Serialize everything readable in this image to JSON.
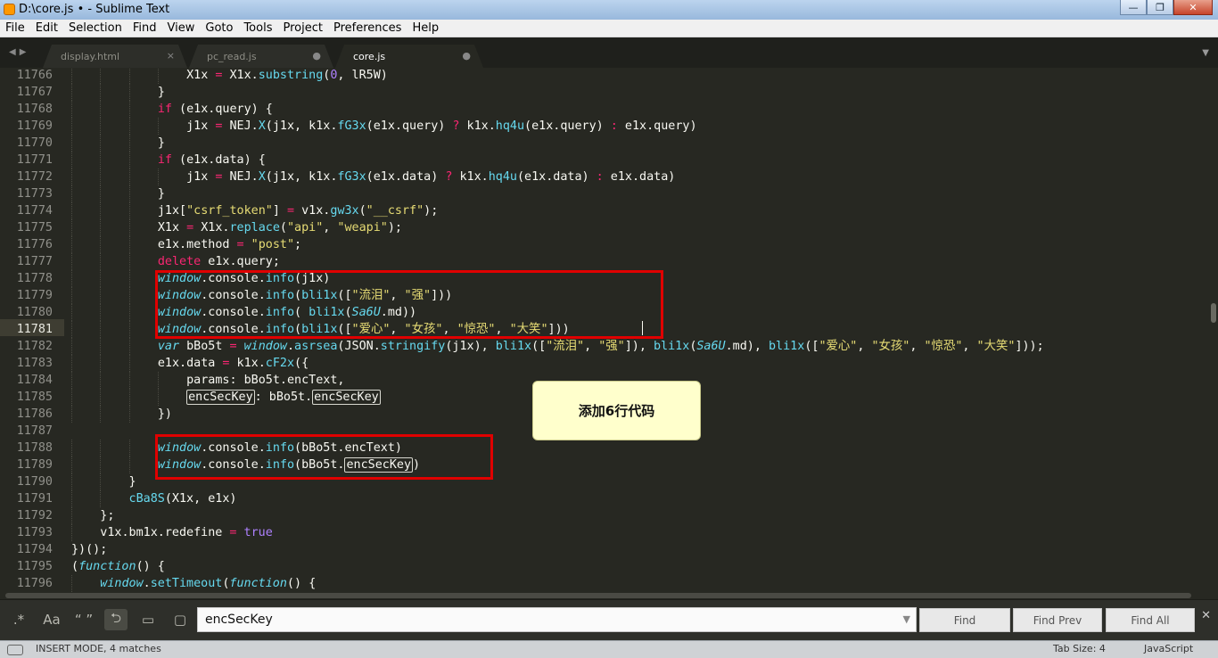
{
  "window": {
    "title": "D:\\core.js • - Sublime Text",
    "controls": {
      "minimize": "—",
      "maximize": "❐",
      "close": "✕"
    }
  },
  "menu": [
    "File",
    "Edit",
    "Selection",
    "Find",
    "View",
    "Goto",
    "Tools",
    "Project",
    "Preferences",
    "Help"
  ],
  "tabs": [
    {
      "label": "display.html",
      "marker": "×",
      "active": false
    },
    {
      "label": "pc_read.js",
      "marker": "●",
      "active": false
    },
    {
      "label": "core.js",
      "marker": "●",
      "active": true
    }
  ],
  "editor": {
    "current_line": "11781",
    "lines": [
      {
        "n": "11766",
        "indent": 4,
        "segs": [
          {
            "t": "X1x ",
            "c": ""
          },
          {
            "t": "=",
            "c": "kw"
          },
          {
            "t": " X1x.",
            "c": ""
          },
          {
            "t": "substring",
            "c": "fn"
          },
          {
            "t": "(",
            "c": ""
          },
          {
            "t": "0",
            "c": "num"
          },
          {
            "t": ", lR5W)",
            "c": ""
          }
        ]
      },
      {
        "n": "11767",
        "indent": 3,
        "segs": [
          {
            "t": "}",
            "c": ""
          }
        ]
      },
      {
        "n": "11768",
        "indent": 3,
        "segs": [
          {
            "t": "if",
            "c": "kw"
          },
          {
            "t": " (e1x.query) {",
            "c": ""
          }
        ]
      },
      {
        "n": "11769",
        "indent": 4,
        "segs": [
          {
            "t": "j1x ",
            "c": ""
          },
          {
            "t": "=",
            "c": "kw"
          },
          {
            "t": " NEJ.",
            "c": ""
          },
          {
            "t": "X",
            "c": "fn"
          },
          {
            "t": "(j1x, k1x.",
            "c": ""
          },
          {
            "t": "fG3x",
            "c": "fn"
          },
          {
            "t": "(e1x.query) ",
            "c": ""
          },
          {
            "t": "?",
            "c": "kw"
          },
          {
            "t": " k1x.",
            "c": ""
          },
          {
            "t": "hq4u",
            "c": "fn"
          },
          {
            "t": "(e1x.query) ",
            "c": ""
          },
          {
            "t": ":",
            "c": "kw"
          },
          {
            "t": " e1x.query)",
            "c": ""
          }
        ]
      },
      {
        "n": "11770",
        "indent": 3,
        "segs": [
          {
            "t": "}",
            "c": ""
          }
        ]
      },
      {
        "n": "11771",
        "indent": 3,
        "segs": [
          {
            "t": "if",
            "c": "kw"
          },
          {
            "t": " (e1x.data) {",
            "c": ""
          }
        ]
      },
      {
        "n": "11772",
        "indent": 4,
        "segs": [
          {
            "t": "j1x ",
            "c": ""
          },
          {
            "t": "=",
            "c": "kw"
          },
          {
            "t": " NEJ.",
            "c": ""
          },
          {
            "t": "X",
            "c": "fn"
          },
          {
            "t": "(j1x, k1x.",
            "c": ""
          },
          {
            "t": "fG3x",
            "c": "fn"
          },
          {
            "t": "(e1x.data) ",
            "c": ""
          },
          {
            "t": "?",
            "c": "kw"
          },
          {
            "t": " k1x.",
            "c": ""
          },
          {
            "t": "hq4u",
            "c": "fn"
          },
          {
            "t": "(e1x.data) ",
            "c": ""
          },
          {
            "t": ":",
            "c": "kw"
          },
          {
            "t": " e1x.data)",
            "c": ""
          }
        ]
      },
      {
        "n": "11773",
        "indent": 3,
        "segs": [
          {
            "t": "}",
            "c": ""
          }
        ]
      },
      {
        "n": "11774",
        "indent": 3,
        "segs": [
          {
            "t": "j1x[",
            "c": ""
          },
          {
            "t": "\"csrf_token\"",
            "c": "str"
          },
          {
            "t": "] ",
            "c": ""
          },
          {
            "t": "=",
            "c": "kw"
          },
          {
            "t": " v1x.",
            "c": ""
          },
          {
            "t": "gw3x",
            "c": "fn"
          },
          {
            "t": "(",
            "c": ""
          },
          {
            "t": "\"__csrf\"",
            "c": "str"
          },
          {
            "t": ");",
            "c": ""
          }
        ]
      },
      {
        "n": "11775",
        "indent": 3,
        "segs": [
          {
            "t": "X1x ",
            "c": ""
          },
          {
            "t": "=",
            "c": "kw"
          },
          {
            "t": " X1x.",
            "c": ""
          },
          {
            "t": "replace",
            "c": "fn"
          },
          {
            "t": "(",
            "c": ""
          },
          {
            "t": "\"api\"",
            "c": "str"
          },
          {
            "t": ", ",
            "c": ""
          },
          {
            "t": "\"weapi\"",
            "c": "str"
          },
          {
            "t": ");",
            "c": ""
          }
        ]
      },
      {
        "n": "11776",
        "indent": 3,
        "segs": [
          {
            "t": "e1x.method ",
            "c": ""
          },
          {
            "t": "=",
            "c": "kw"
          },
          {
            "t": " ",
            "c": ""
          },
          {
            "t": "\"post\"",
            "c": "str"
          },
          {
            "t": ";",
            "c": ""
          }
        ]
      },
      {
        "n": "11777",
        "indent": 3,
        "segs": [
          {
            "t": "delete",
            "c": "kw"
          },
          {
            "t": " e1x.query;",
            "c": ""
          }
        ]
      },
      {
        "n": "11778",
        "indent": 3,
        "segs": [
          {
            "t": "window",
            "c": "it"
          },
          {
            "t": ".console.",
            "c": ""
          },
          {
            "t": "info",
            "c": "fn"
          },
          {
            "t": "(j1x)",
            "c": ""
          }
        ]
      },
      {
        "n": "11779",
        "indent": 3,
        "segs": [
          {
            "t": "window",
            "c": "it"
          },
          {
            "t": ".console.",
            "c": ""
          },
          {
            "t": "info",
            "c": "fn"
          },
          {
            "t": "(",
            "c": ""
          },
          {
            "t": "bli1x",
            "c": "fn"
          },
          {
            "t": "([",
            "c": ""
          },
          {
            "t": "\"流泪\"",
            "c": "str"
          },
          {
            "t": ", ",
            "c": ""
          },
          {
            "t": "\"强\"",
            "c": "str"
          },
          {
            "t": "]))",
            "c": ""
          }
        ]
      },
      {
        "n": "11780",
        "indent": 3,
        "segs": [
          {
            "t": "window",
            "c": "it"
          },
          {
            "t": ".console.",
            "c": ""
          },
          {
            "t": "info",
            "c": "fn"
          },
          {
            "t": "( ",
            "c": ""
          },
          {
            "t": "bli1x",
            "c": "fn"
          },
          {
            "t": "(",
            "c": ""
          },
          {
            "t": "Sa6U",
            "c": "it"
          },
          {
            "t": ".md))",
            "c": ""
          }
        ]
      },
      {
        "n": "11781",
        "indent": 3,
        "segs": [
          {
            "t": "window",
            "c": "it"
          },
          {
            "t": ".console.",
            "c": ""
          },
          {
            "t": "info",
            "c": "fn"
          },
          {
            "t": "(",
            "c": ""
          },
          {
            "t": "bli1x",
            "c": "fn"
          },
          {
            "t": "([",
            "c": ""
          },
          {
            "t": "\"爱心\"",
            "c": "str"
          },
          {
            "t": ", ",
            "c": ""
          },
          {
            "t": "\"女孩\"",
            "c": "str"
          },
          {
            "t": ", ",
            "c": ""
          },
          {
            "t": "\"惊恐\"",
            "c": "str"
          },
          {
            "t": ", ",
            "c": ""
          },
          {
            "t": "\"大笑\"",
            "c": "str"
          },
          {
            "t": "]))",
            "c": ""
          }
        ]
      },
      {
        "n": "11782",
        "indent": 3,
        "segs": [
          {
            "t": "var",
            "c": "it"
          },
          {
            "t": " bBo5t ",
            "c": ""
          },
          {
            "t": "=",
            "c": "kw"
          },
          {
            "t": " ",
            "c": ""
          },
          {
            "t": "window",
            "c": "it"
          },
          {
            "t": ".",
            "c": ""
          },
          {
            "t": "asrsea",
            "c": "fn"
          },
          {
            "t": "(JSON.",
            "c": ""
          },
          {
            "t": "stringify",
            "c": "fn"
          },
          {
            "t": "(j1x), ",
            "c": ""
          },
          {
            "t": "bli1x",
            "c": "fn"
          },
          {
            "t": "([",
            "c": ""
          },
          {
            "t": "\"流泪\"",
            "c": "str"
          },
          {
            "t": ", ",
            "c": ""
          },
          {
            "t": "\"强\"",
            "c": "str"
          },
          {
            "t": "]), ",
            "c": ""
          },
          {
            "t": "bli1x",
            "c": "fn"
          },
          {
            "t": "(",
            "c": ""
          },
          {
            "t": "Sa6U",
            "c": "it"
          },
          {
            "t": ".md), ",
            "c": ""
          },
          {
            "t": "bli1x",
            "c": "fn"
          },
          {
            "t": "([",
            "c": ""
          },
          {
            "t": "\"爱心\"",
            "c": "str"
          },
          {
            "t": ", ",
            "c": ""
          },
          {
            "t": "\"女孩\"",
            "c": "str"
          },
          {
            "t": ", ",
            "c": ""
          },
          {
            "t": "\"惊恐\"",
            "c": "str"
          },
          {
            "t": ", ",
            "c": ""
          },
          {
            "t": "\"大笑\"",
            "c": "str"
          },
          {
            "t": "]));",
            "c": ""
          }
        ]
      },
      {
        "n": "11783",
        "indent": 3,
        "segs": [
          {
            "t": "e1x.data ",
            "c": ""
          },
          {
            "t": "=",
            "c": "kw"
          },
          {
            "t": " k1x.",
            "c": ""
          },
          {
            "t": "cF2x",
            "c": "fn"
          },
          {
            "t": "({",
            "c": ""
          }
        ]
      },
      {
        "n": "11784",
        "indent": 4,
        "segs": [
          {
            "t": "params: bBo5t.encText,",
            "c": ""
          }
        ]
      },
      {
        "n": "11785",
        "indent": 4,
        "segs": [
          {
            "t": "encSecKey",
            "c": "box"
          },
          {
            "t": ": bBo5t.",
            "c": ""
          },
          {
            "t": "encSecKey",
            "c": "box"
          }
        ]
      },
      {
        "n": "11786",
        "indent": 3,
        "segs": [
          {
            "t": "})",
            "c": ""
          }
        ]
      },
      {
        "n": "11787",
        "indent": 0,
        "segs": []
      },
      {
        "n": "11788",
        "indent": 3,
        "segs": [
          {
            "t": "window",
            "c": "it"
          },
          {
            "t": ".console.",
            "c": ""
          },
          {
            "t": "info",
            "c": "fn"
          },
          {
            "t": "(bBo5t.encText)",
            "c": ""
          }
        ]
      },
      {
        "n": "11789",
        "indent": 3,
        "segs": [
          {
            "t": "window",
            "c": "it"
          },
          {
            "t": ".console.",
            "c": ""
          },
          {
            "t": "info",
            "c": "fn"
          },
          {
            "t": "(bBo5t.",
            "c": ""
          },
          {
            "t": "encSecKey",
            "c": "box"
          },
          {
            "t": ")",
            "c": ""
          }
        ]
      },
      {
        "n": "11790",
        "indent": 2,
        "segs": [
          {
            "t": "}",
            "c": ""
          }
        ]
      },
      {
        "n": "11791",
        "indent": 2,
        "segs": [
          {
            "t": "cBa8S",
            "c": "fn"
          },
          {
            "t": "(X1x, e1x)",
            "c": ""
          }
        ]
      },
      {
        "n": "11792",
        "indent": 1,
        "segs": [
          {
            "t": "};",
            "c": ""
          }
        ]
      },
      {
        "n": "11793",
        "indent": 1,
        "segs": [
          {
            "t": "v1x.bm1x.redefine ",
            "c": ""
          },
          {
            "t": "=",
            "c": "kw"
          },
          {
            "t": " ",
            "c": ""
          },
          {
            "t": "true",
            "c": "bool"
          }
        ]
      },
      {
        "n": "11794",
        "indent": 0,
        "segs": [
          {
            "t": "})();",
            "c": ""
          }
        ]
      },
      {
        "n": "11795",
        "indent": 0,
        "segs": [
          {
            "t": "(",
            "c": ""
          },
          {
            "t": "function",
            "c": "it"
          },
          {
            "t": "() {",
            "c": ""
          }
        ]
      },
      {
        "n": "11796",
        "indent": 1,
        "segs": [
          {
            "t": "window",
            "c": "it"
          },
          {
            "t": ".",
            "c": ""
          },
          {
            "t": "setTimeout",
            "c": "fn"
          },
          {
            "t": "(",
            "c": ""
          },
          {
            "t": "function",
            "c": "it"
          },
          {
            "t": "() {",
            "c": ""
          }
        ]
      }
    ]
  },
  "annotation": {
    "callout": "添加6行代码"
  },
  "find_panel": {
    "options": [
      {
        "name": "regex-toggle",
        "glyph": ".*"
      },
      {
        "name": "case-sensitive-toggle",
        "glyph": "Aa"
      },
      {
        "name": "whole-word-toggle",
        "glyph": "“ ”"
      },
      {
        "name": "wrap-toggle",
        "glyph": "⮌"
      },
      {
        "name": "in-selection-toggle",
        "glyph": "▭"
      },
      {
        "name": "highlight-matches-toggle",
        "glyph": "▢"
      }
    ],
    "query": "encSecKey",
    "buttons": {
      "find": "Find",
      "find_prev": "Find Prev",
      "find_all": "Find All"
    },
    "close": "✕"
  },
  "status": {
    "left": "INSERT MODE, 4 matches",
    "tab_size": "Tab Size: 4",
    "syntax": "JavaScript"
  },
  "colors": {
    "editor_bg": "#272822",
    "annotation_red": "#e00000",
    "callout_bg": "#ffffcc"
  }
}
